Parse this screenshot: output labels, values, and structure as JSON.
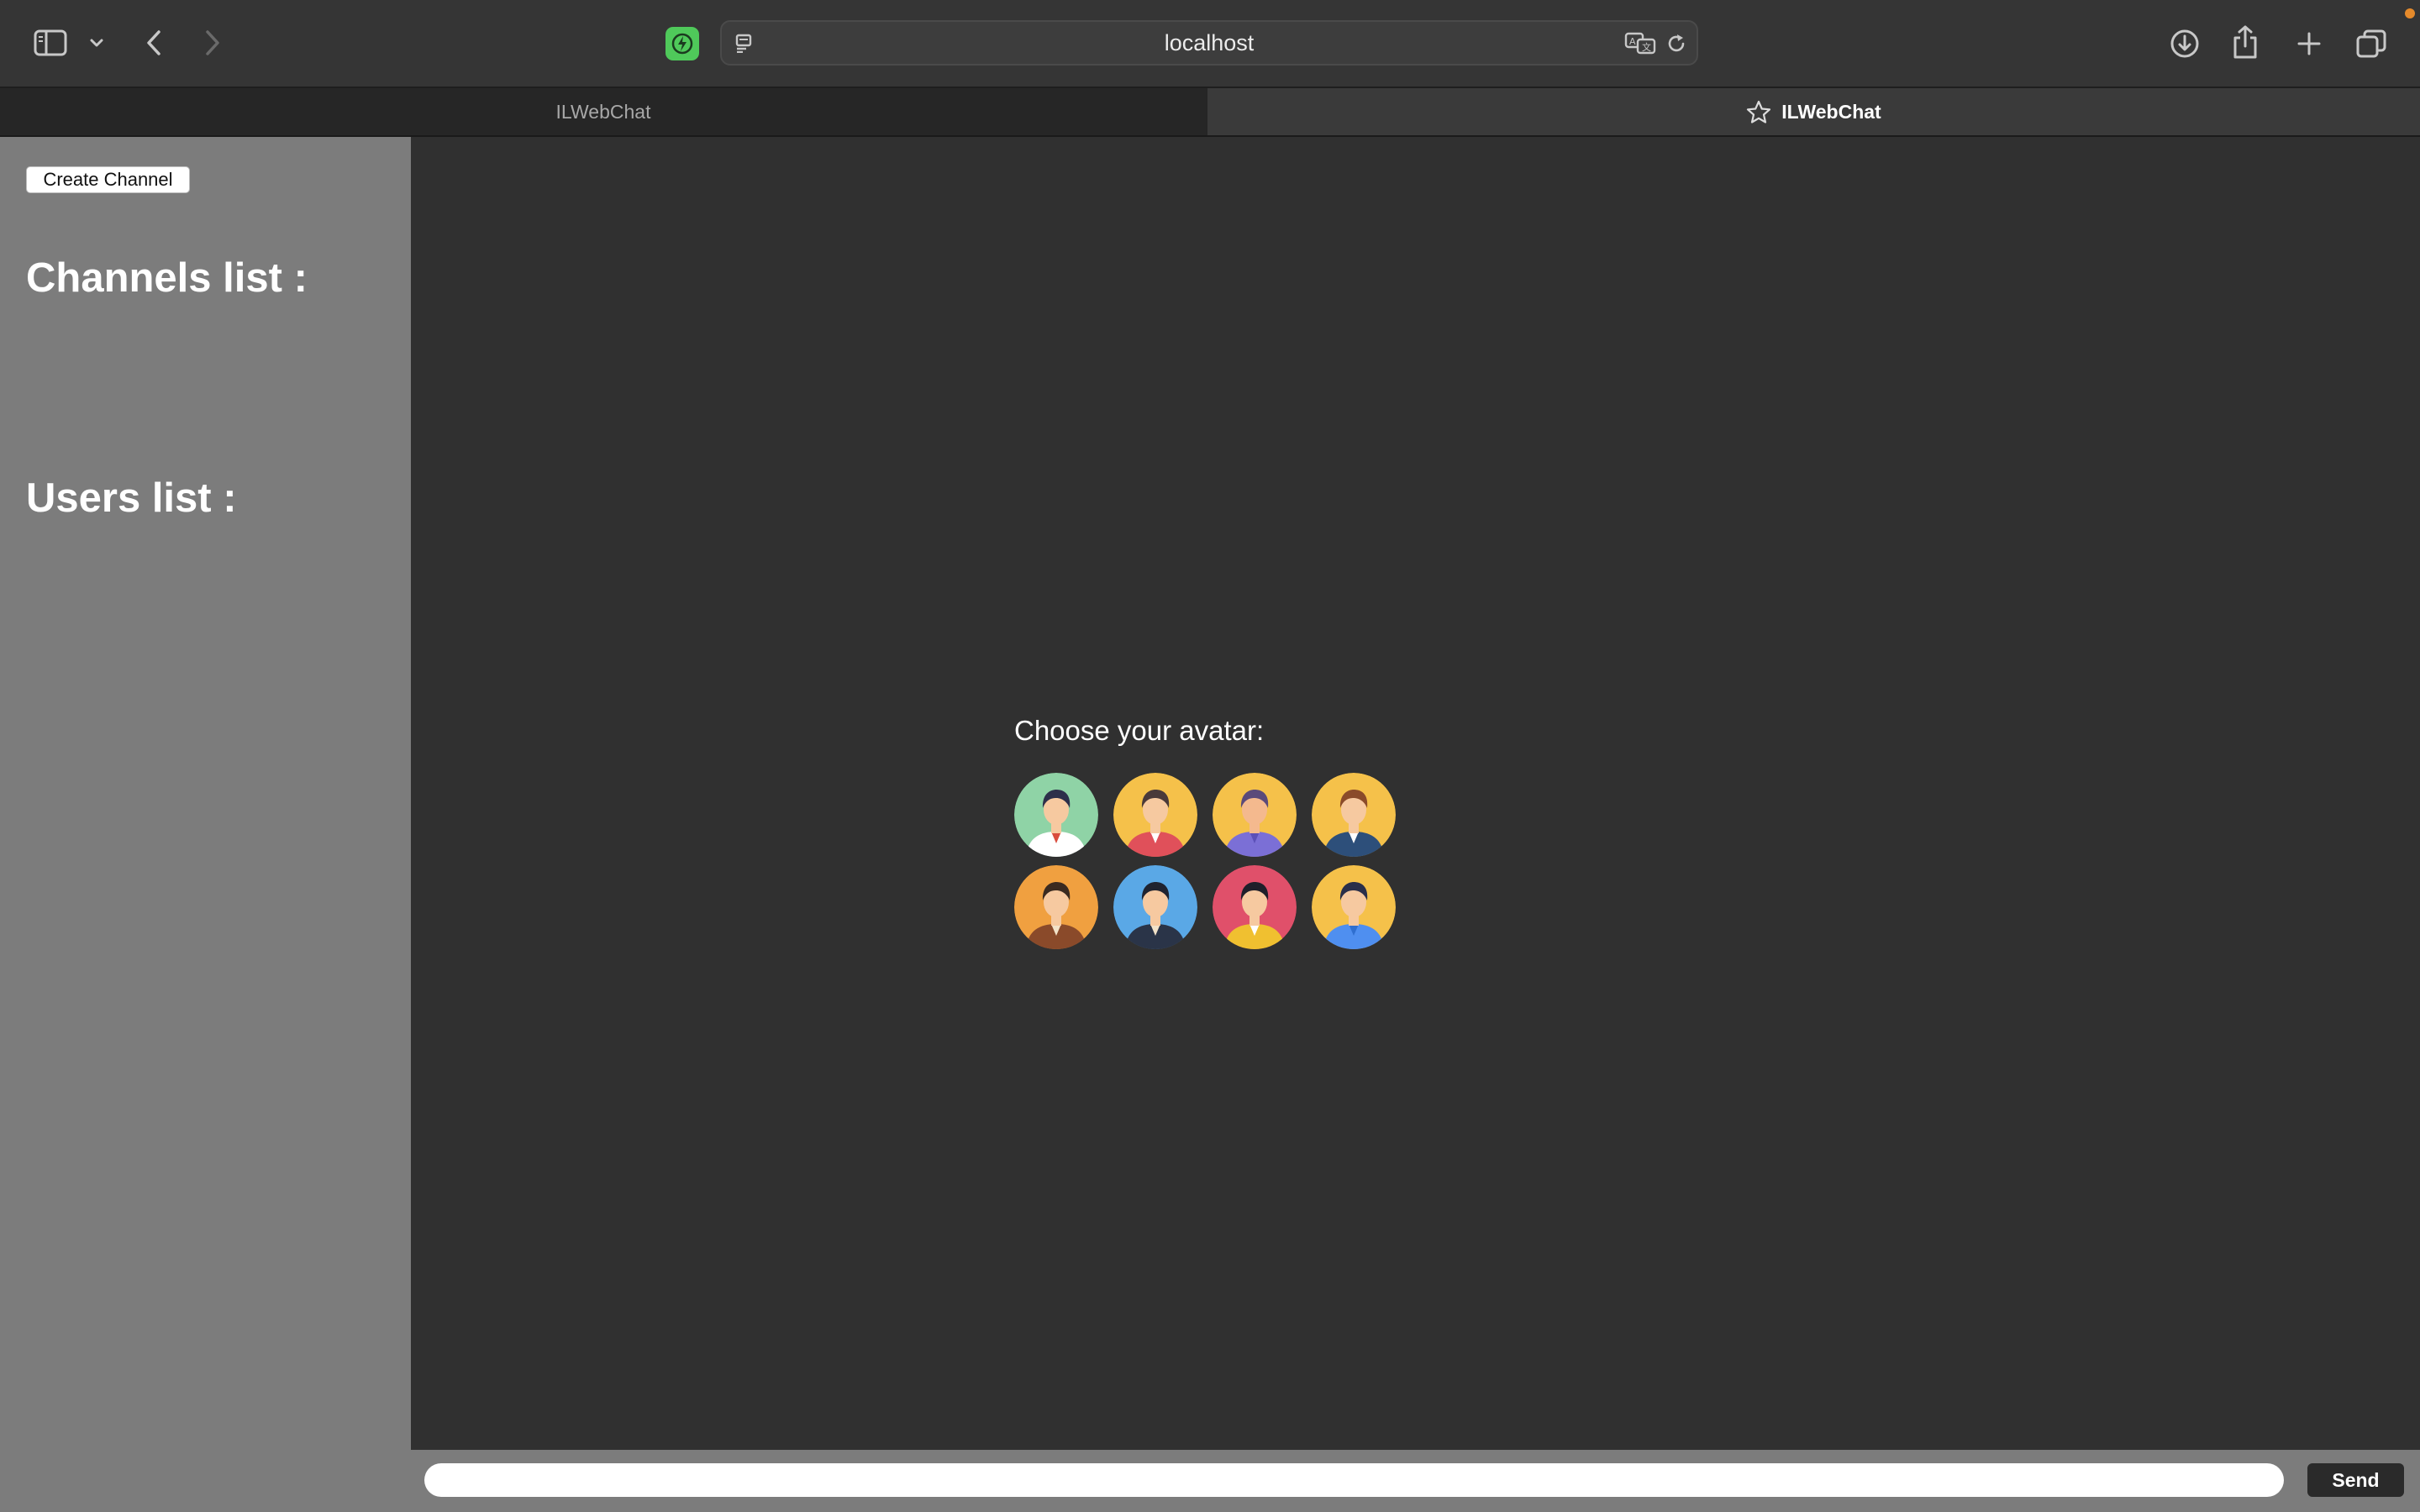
{
  "browser": {
    "address": "localhost",
    "tabs": [
      {
        "label": "ILWebChat",
        "active": false
      },
      {
        "label": "ILWebChat",
        "active": true
      }
    ],
    "icons": [
      "sidebar-toggle-icon",
      "chevron-down-icon",
      "back-icon",
      "forward-icon",
      "extension-icon",
      "reader-icon",
      "translate-icon",
      "reload-icon",
      "download-icon",
      "share-icon",
      "new-tab-icon",
      "tab-overview-icon",
      "star-icon"
    ]
  },
  "sidebar": {
    "create_channel_label": "Create Channel",
    "channels_title": "Channels list :",
    "users_title": "Users list :"
  },
  "main": {
    "avatar_prompt": "Choose your avatar:",
    "avatars": [
      {
        "name": "man-red-tie",
        "bg": "#8fd3a6",
        "skin": "#f6c9a0",
        "hair": "#2d2f4a",
        "shirt": "#ffffff",
        "accent": "#d94c3d"
      },
      {
        "name": "woman-red-top",
        "bg": "#f5c14a",
        "skin": "#f6c9a0",
        "hair": "#4a3a3a",
        "shirt": "#e0505a",
        "accent": "#ffffff"
      },
      {
        "name": "man-purple-shirt",
        "bg": "#f5c14a",
        "skin": "#f4b98e",
        "hair": "#5b4a7a",
        "shirt": "#7b6fd6",
        "accent": "#5c50b8"
      },
      {
        "name": "man-suit",
        "bg": "#f5c14a",
        "skin": "#f6c9a0",
        "hair": "#8a4b2a",
        "shirt": "#2d4f7a",
        "accent": "#ffffff"
      },
      {
        "name": "man-brown-jacket",
        "bg": "#f0a040",
        "skin": "#f6c9a0",
        "hair": "#3a2a20",
        "shirt": "#8a4a2a",
        "accent": "#f2e2c8"
      },
      {
        "name": "man-dark-hoodie",
        "bg": "#5aa8e6",
        "skin": "#f6c9a0",
        "hair": "#1f2330",
        "shirt": "#2a3448",
        "accent": "#f2e2c8"
      },
      {
        "name": "woman-yellow-top",
        "bg": "#e0506a",
        "skin": "#f6c9a0",
        "hair": "#1f1f2a",
        "shirt": "#f0c030",
        "accent": "#ffffff"
      },
      {
        "name": "woman-blue-shirt",
        "bg": "#f5c14a",
        "skin": "#f6c9a0",
        "hair": "#2a2f4a",
        "shirt": "#4f8ff0",
        "accent": "#2f6fd0"
      }
    ]
  },
  "footer": {
    "message_value": "",
    "send_label": "Send"
  },
  "colors": {
    "sidebar_bg": "#7c7c7c",
    "main_bg": "#303030",
    "extension_badge": "#4fc95a",
    "notification_dot": "#e58a2b"
  }
}
